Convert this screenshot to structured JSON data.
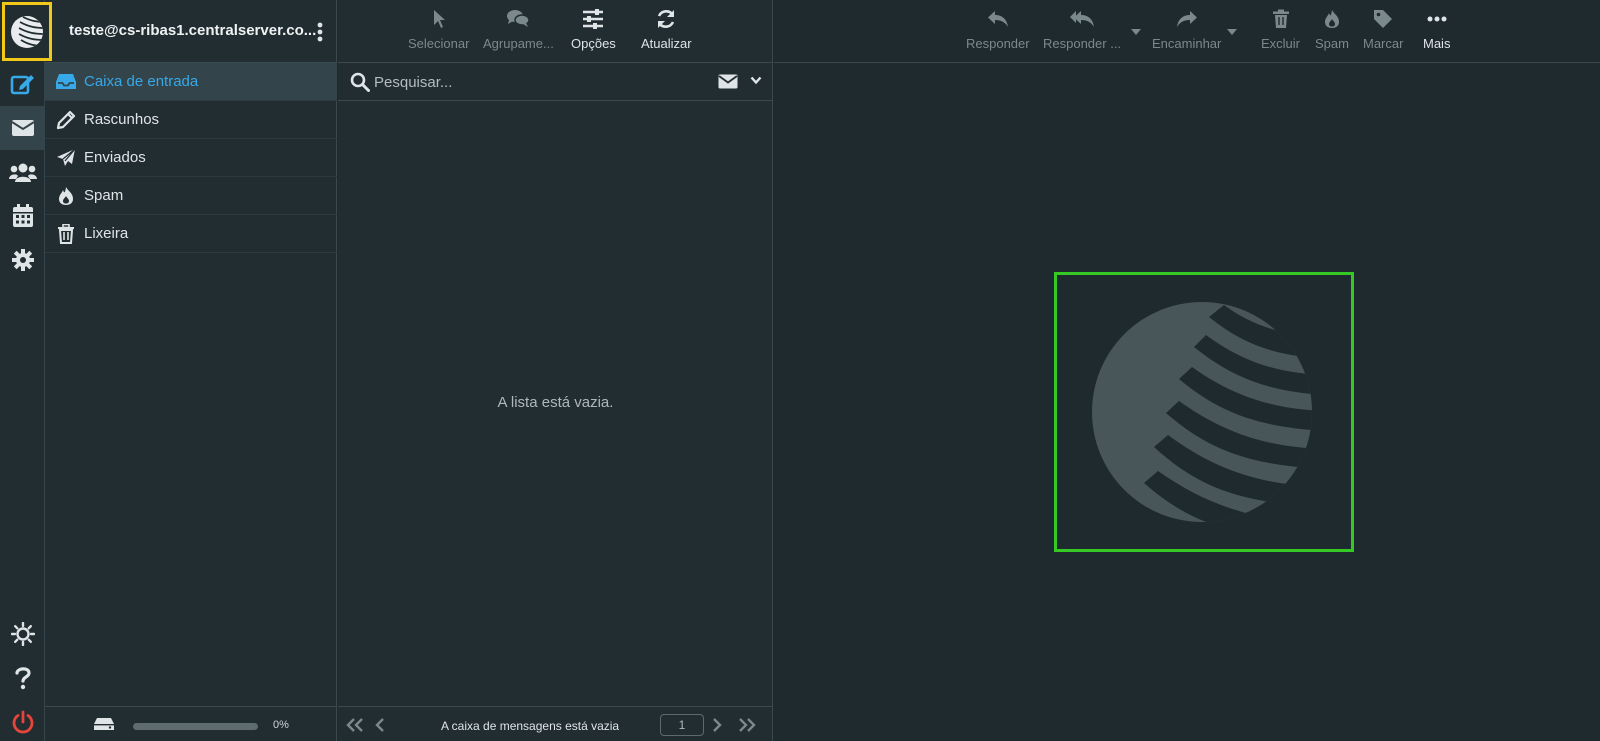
{
  "rail": {
    "items": [
      {
        "name": "compose",
        "icon": "compose-icon",
        "active": false
      },
      {
        "name": "mail",
        "icon": "envelope-icon",
        "active": true
      },
      {
        "name": "contacts",
        "icon": "users-icon",
        "active": false
      },
      {
        "name": "calendar",
        "icon": "calendar-icon",
        "active": false
      },
      {
        "name": "settings",
        "icon": "gear-icon",
        "active": false
      }
    ],
    "bottom": [
      {
        "name": "theme",
        "icon": "sun-icon"
      },
      {
        "name": "help",
        "icon": "question-icon"
      },
      {
        "name": "logout",
        "icon": "power-icon"
      }
    ]
  },
  "account": {
    "email": "teste@cs-ribas1.centralserver.co..."
  },
  "folders": [
    {
      "label": "Caixa de entrada",
      "icon": "inbox-icon",
      "active": true
    },
    {
      "label": "Rascunhos",
      "icon": "pencil-icon",
      "active": false
    },
    {
      "label": "Enviados",
      "icon": "paper-plane-icon",
      "active": false
    },
    {
      "label": "Spam",
      "icon": "fire-icon",
      "active": false
    },
    {
      "label": "Lixeira",
      "icon": "trash-icon",
      "active": false
    }
  ],
  "quota": {
    "percent_label": "0%",
    "fraction": 0
  },
  "list_toolbar": {
    "select": "Selecionar",
    "group": "Agrupame...",
    "options": "Opções",
    "refresh": "Atualizar"
  },
  "search": {
    "placeholder": "Pesquisar..."
  },
  "list": {
    "empty_text": "A lista está vazia."
  },
  "pager": {
    "status": "A caixa de mensagens está vazia",
    "page": "1"
  },
  "preview_toolbar": {
    "reply": "Responder",
    "reply_all": "Responder ...",
    "forward": "Encaminhar",
    "delete": "Excluir",
    "spam": "Spam",
    "mark": "Marcar",
    "more": "Mais"
  },
  "colors": {
    "accent": "#37a8e8",
    "background": "#1f2a2e",
    "panel": "#222d31",
    "logo_highlight": "#f2c919",
    "watermark_highlight": "#34c924",
    "logout": "#e5453b"
  }
}
